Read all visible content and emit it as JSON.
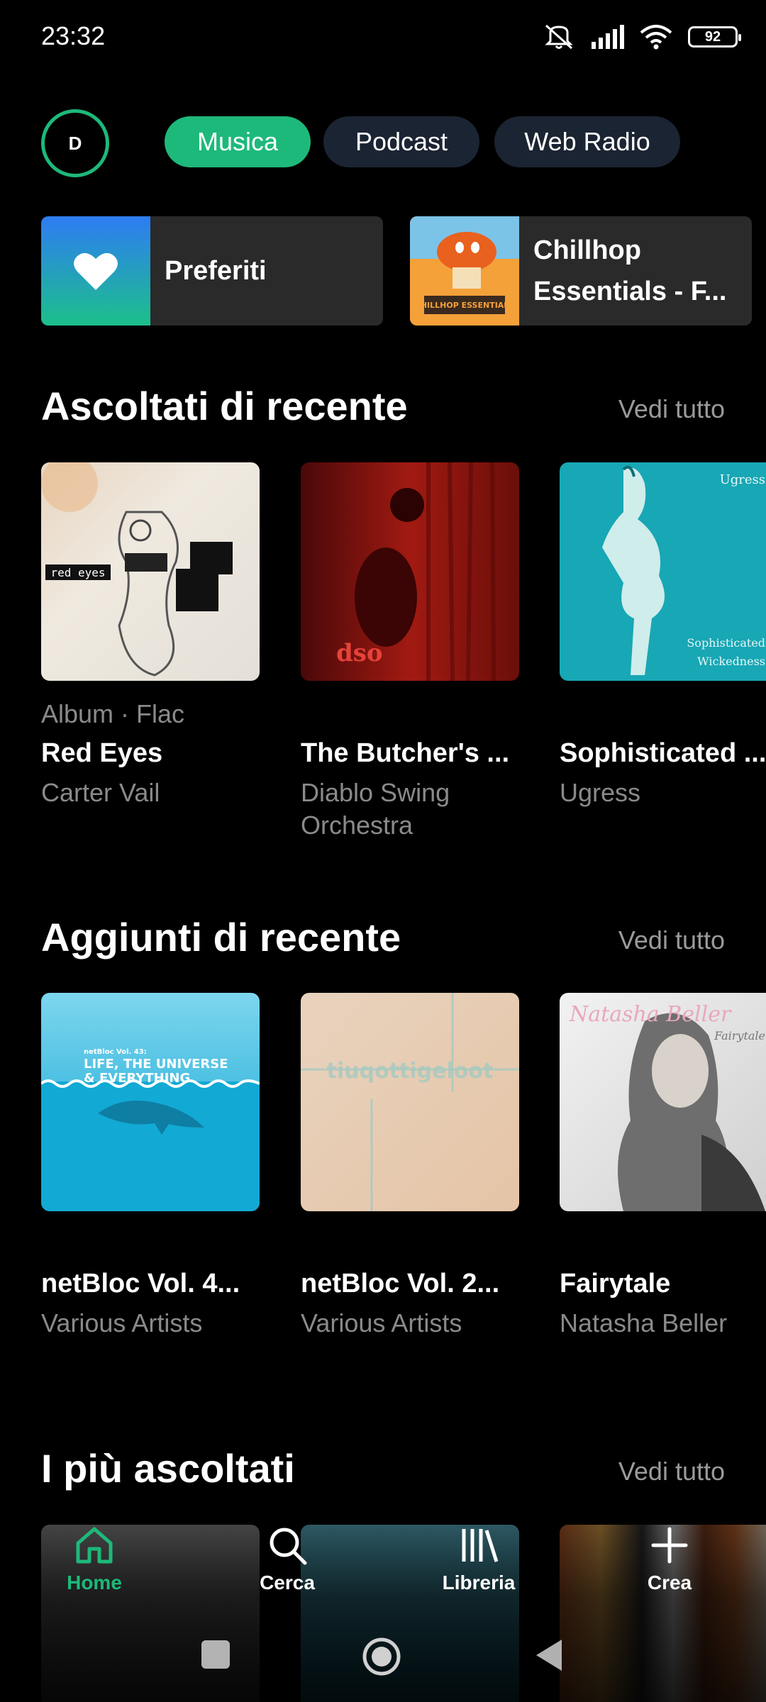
{
  "status_bar": {
    "time": "23:32",
    "battery": "92",
    "icons": [
      "mute-icon",
      "signal-icon",
      "wifi-icon",
      "battery-icon"
    ]
  },
  "header": {
    "avatar_initial": "D",
    "chips": [
      {
        "label": "Musica",
        "active": true
      },
      {
        "label": "Podcast",
        "active": false
      },
      {
        "label": "Web Radio",
        "active": false
      }
    ]
  },
  "shortcuts": [
    {
      "label": "Preferiti",
      "icon": "heart-icon"
    },
    {
      "label_line1": "Chillhop",
      "label_line2": "Essentials - F...",
      "art_text": "CHILLHOP ESSENTIALS"
    }
  ],
  "recently_played": {
    "title": "Ascoltati di recente",
    "see_all": "Vedi tutto",
    "items": [
      {
        "meta": "Album · Flac",
        "title": "Red Eyes",
        "artist": "Carter Vail",
        "art_text": "red eyes"
      },
      {
        "meta": "",
        "title": "The Butcher's ...",
        "artist_line1": "Diablo Swing",
        "artist_line2": "Orchestra",
        "art_text": "dso"
      },
      {
        "meta": "",
        "title": "Sophisticated ...",
        "artist": "Ugress",
        "art_text_top": "Ugress",
        "art_text_bottom1": "Sophisticated",
        "art_text_bottom2": "Wickedness"
      }
    ]
  },
  "recently_added": {
    "title": "Aggiunti di recente",
    "see_all": "Vedi tutto",
    "items": [
      {
        "title": "netBloc Vol. 4...",
        "artist": "Various Artists",
        "art_small": "netBloc Vol. 43:",
        "art_line1": "LIFE, THE UNIVERSE",
        "art_line2": "& EVERYTHING"
      },
      {
        "title": "netBloc Vol. 2...",
        "artist": "Various Artists",
        "art_text": "tiuqottigeloot"
      },
      {
        "title": "Fairytale",
        "artist": "Natasha Beller",
        "art_line1": "Natasha Beller",
        "art_line2": "Fairytale"
      }
    ]
  },
  "most_played": {
    "title": "I più ascoltati",
    "see_all": "Vedi tutto"
  },
  "bottom_nav": [
    {
      "label": "Home",
      "icon": "home-icon",
      "active": true
    },
    {
      "label": "Cerca",
      "icon": "search-icon",
      "active": false
    },
    {
      "label": "Libreria",
      "icon": "library-icon",
      "active": false
    },
    {
      "label": "Crea",
      "icon": "plus-icon",
      "active": false
    }
  ],
  "colors": {
    "accent": "#1DB97A",
    "chip_bg": "#1B2432",
    "card_bg": "#2A2A2A",
    "muted_text": "#8a8a8a"
  }
}
